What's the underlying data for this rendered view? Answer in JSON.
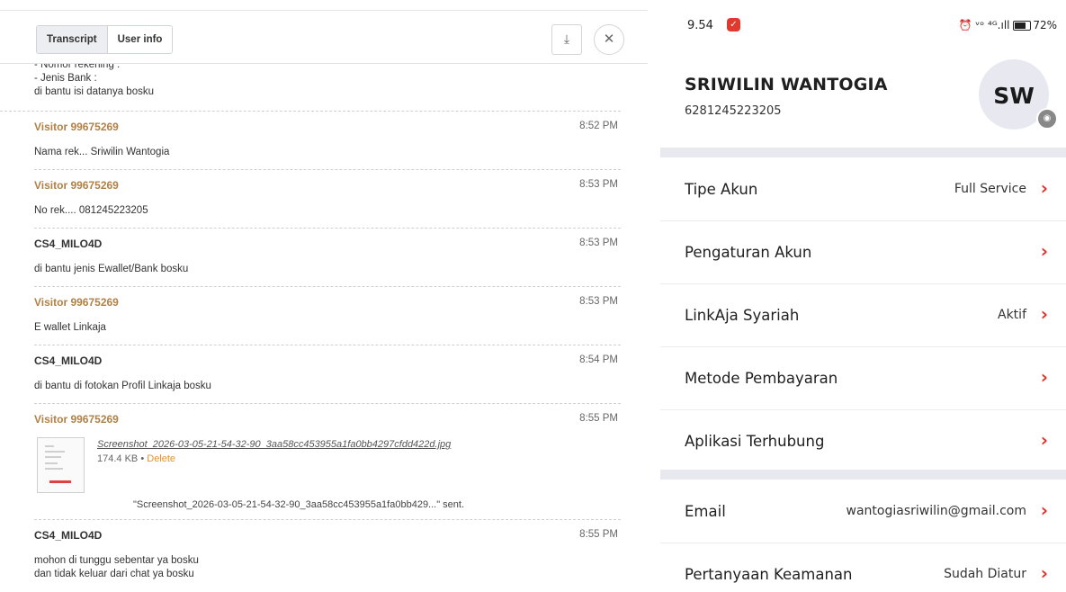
{
  "transcript_panel": {
    "tabs": [
      {
        "label": "Transcript",
        "active": true
      },
      {
        "label": "User info",
        "active": false
      }
    ],
    "download_icon": "download-icon",
    "close_icon": "close-icon",
    "first_message_lines": [
      "- Nomor rekening :",
      "- Jenis Bank :",
      "di bantu isi datanya bosku"
    ],
    "messages": [
      {
        "sender": "Visitor 99675269",
        "role": "visitor",
        "time": "8:52 PM",
        "text": "Nama rek... Sriwilin Wantogia"
      },
      {
        "sender": "Visitor 99675269",
        "role": "visitor",
        "time": "8:53 PM",
        "text": "No rek.... 081245223205"
      },
      {
        "sender": "CS4_MILO4D",
        "role": "agent",
        "time": "8:53 PM",
        "text": "di bantu jenis Ewallet/Bank bosku"
      },
      {
        "sender": "Visitor 99675269",
        "role": "visitor",
        "time": "8:53 PM",
        "text": "E wallet Linkaja"
      },
      {
        "sender": "CS4_MILO4D",
        "role": "agent",
        "time": "8:54 PM",
        "text": "di bantu di fotokan Profil Linkaja bosku"
      }
    ],
    "file_message": {
      "sender": "Visitor 99675269",
      "time": "8:55 PM",
      "file_name": "Screenshot_2026-03-05-21-54-32-90_3aa58cc453955a1fa0bb4297cfdd422d.jpg",
      "file_size": "174.4 KB",
      "bullet": "•",
      "delete_label": "Delete",
      "sent_text": "\"Screenshot_2026-03-05-21-54-32-90_3aa58cc453955a1fa0bb429...\" sent."
    },
    "last_message": {
      "sender": "CS4_MILO4D",
      "time": "8:55 PM",
      "line1": "mohon di tunggu sebentar ya bosku",
      "line2": "dan tidak keluar dari chat ya bosku"
    }
  },
  "phone": {
    "status_bar": {
      "time": "9.54",
      "notification_icon": "app-notification-icon",
      "right_text": "⏰ ᵛᵒ ⁴ᴳ.ıll",
      "battery": "72%"
    },
    "profile": {
      "name": "SRIWILIN WANTOGIA",
      "phone": "6281245223205",
      "initials": "SW",
      "camera_icon": "camera-icon"
    },
    "rows": [
      {
        "label": "Tipe Akun",
        "value": "Full Service"
      },
      {
        "label": "Pengaturan Akun",
        "value": ""
      },
      {
        "label": "LinkAja Syariah",
        "value": "Aktif"
      },
      {
        "label": "Metode Pembayaran",
        "value": ""
      },
      {
        "label": "Aplikasi Terhubung",
        "value": ""
      },
      {
        "label": "Email",
        "value": "wantogiasriwilin@gmail.com"
      },
      {
        "label": "Pertanyaan Keamanan",
        "value": "Sudah Diatur"
      }
    ],
    "chevron": "›",
    "accent_color": "#e0342b"
  }
}
